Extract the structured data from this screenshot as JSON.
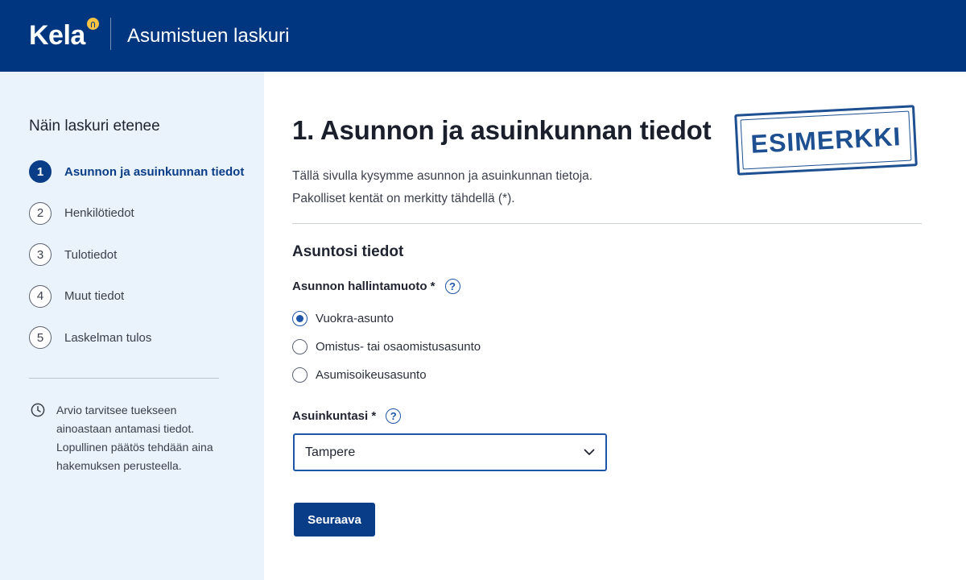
{
  "header": {
    "logo_text": "Kela",
    "title": "Asumistuen laskuri"
  },
  "sidebar": {
    "title": "Näin laskuri etenee",
    "steps": [
      {
        "number": "1",
        "label": "Asunnon ja asuinkunnan tiedot",
        "active": true
      },
      {
        "number": "2",
        "label": "Henkilötiedot",
        "active": false
      },
      {
        "number": "3",
        "label": "Tulotiedot",
        "active": false
      },
      {
        "number": "4",
        "label": "Muut tiedot",
        "active": false
      },
      {
        "number": "5",
        "label": "Laskelman tulos",
        "active": false
      }
    ],
    "note": {
      "icon": "clock-icon",
      "lines": [
        "Arvio tarvitsee tuekseen",
        "ainoastaan antamasi tiedot.",
        "Lopullinen päätös tehdään aina",
        "hakemuksen perusteella."
      ]
    }
  },
  "main": {
    "title": "1. Asunnon ja asuinkunnan tiedot",
    "stamp": "ESIMERKKI",
    "intro": [
      "Tällä sivulla kysymme asunnon ja asuinkunnan tietoja.",
      "Pakolliset kentät on merkitty tähdellä (*)."
    ],
    "section_title": "Asuntosi tiedot",
    "tenure": {
      "label": "Asunnon hallintamuoto *",
      "options": [
        {
          "label": "Vuokra-asunto",
          "checked": true
        },
        {
          "label": "Omistus- tai osaomistusasunto",
          "checked": false
        },
        {
          "label": "Asumisoikeusasunto",
          "checked": false
        }
      ]
    },
    "municipality": {
      "label": "Asuinkuntasi *",
      "value": "Tampere"
    },
    "next_button": "Seuraava"
  },
  "colors": {
    "header_bg": "#003580",
    "accent": "#0a3d87",
    "sidebar_bg": "#eaf2fb",
    "logo_mark": "#f5c243"
  }
}
